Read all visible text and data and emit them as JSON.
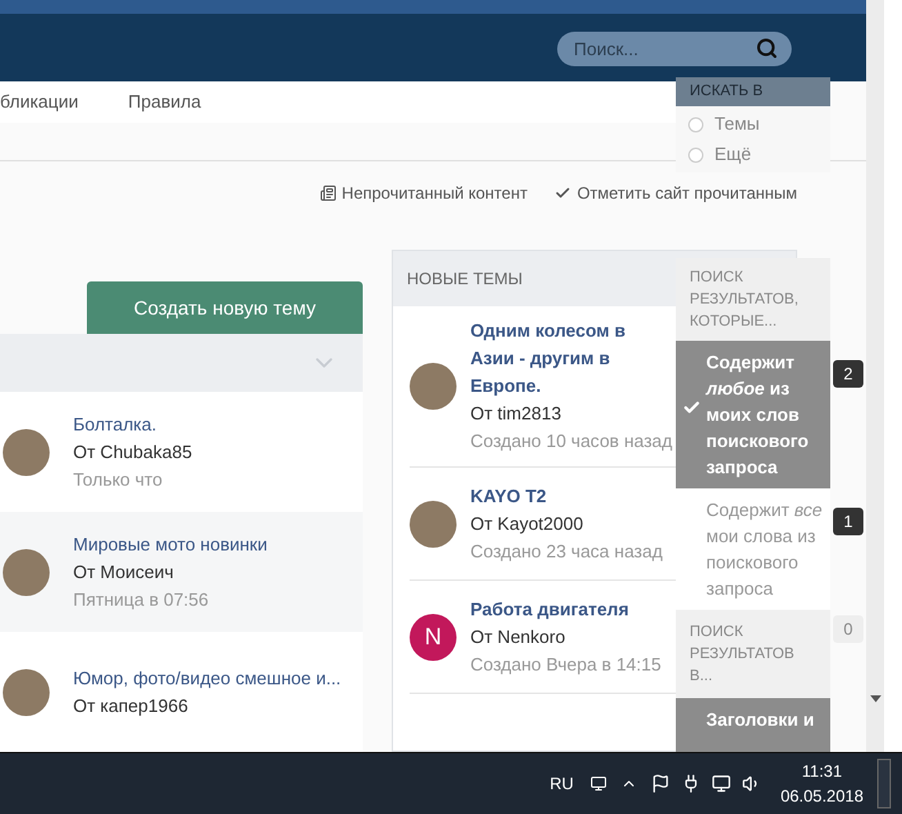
{
  "nav": {
    "items": [
      {
        "label": "бликации",
        "selected": false
      },
      {
        "label": "Правила",
        "selected": false
      }
    ]
  },
  "search": {
    "placeholder": "Поиск..."
  },
  "links": [
    {
      "kind": "unread",
      "label": "Непрочитанный контент"
    },
    {
      "kind": "mark",
      "label": "Отметить сайт прочитанным"
    }
  ],
  "create_button": "Создать новую тему",
  "topics": [
    {
      "title": "Болталка.",
      "author": "От Chubaka85",
      "time": "Только что"
    },
    {
      "title": "Мировые мото новинки",
      "author": "От Моисеич",
      "time": "Пятница в 07:56"
    },
    {
      "title": "Юмор, фото/видео смешное и...",
      "author": "От капер1966"
    }
  ],
  "new_topics": {
    "heading": "НОВЫЕ ТЕМЫ",
    "items": [
      {
        "kind": "photo",
        "title": "Одним колесом в Азии - другим в Европе.",
        "author": "От tim2813",
        "time": "Создано 10 часов назад"
      },
      {
        "kind": "photo",
        "title": "KAYO T2",
        "author": "От Kayot2000",
        "time": "Создано 23 часа назад"
      },
      {
        "kind": "letter",
        "letter": "N",
        "title": "Работа двигателя",
        "author": "От Nenkoro",
        "time": "Создано Вчера в 14:15",
        "color": "#c2185b"
      }
    ]
  },
  "search_menu": {
    "scope_heading": "ИСКАТЬ В",
    "scope_options": [
      {
        "label": "Темы",
        "selected": false
      },
      {
        "label": "Ещё",
        "selected": false
      }
    ],
    "match_heading": "ПОИСК РЕЗУЛЬТАТОВ, КОТОРЫЕ...",
    "match_options": [
      {
        "label": "Содержит *любое* из моих слов поискового запроса",
        "count": "2",
        "selected": true
      },
      {
        "label": "Содержит *все* мои слова из поискового запроса",
        "count": "1",
        "selected": false
      }
    ],
    "faded_count": "0",
    "location_heading": "ПОИСК РЕЗУЛЬТАТОВ В...",
    "location_options": [
      {
        "label": "Заголовки и",
        "selected": true
      }
    ]
  },
  "taskbar": {
    "language": "RU",
    "time": "11:31",
    "date": "06.05.2018"
  }
}
